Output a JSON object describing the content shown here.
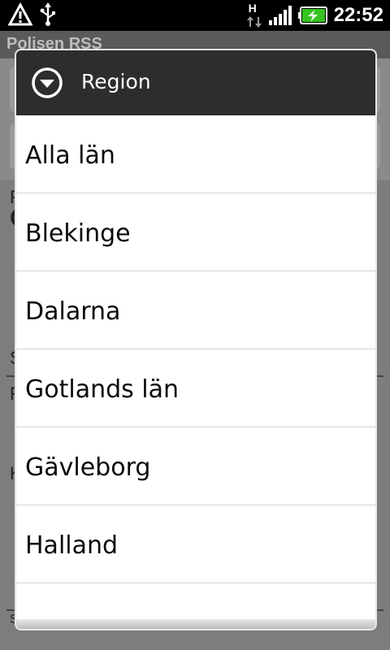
{
  "status_bar": {
    "time": "22:52",
    "icons": [
      "alert-icon",
      "usb-icon",
      "network-hsdpa-icon",
      "signal-icon",
      "battery-charging-icon"
    ],
    "network_label": "H"
  },
  "app": {
    "title": "Polisen RSS",
    "background_fragments": [
      "F",
      "C",
      "S",
      "F",
      "K",
      "S"
    ]
  },
  "dialog": {
    "title": "Region",
    "items": [
      {
        "label": "Alla län"
      },
      {
        "label": "Blekinge"
      },
      {
        "label": "Dalarna"
      },
      {
        "label": "Gotlands län"
      },
      {
        "label": "Gävleborg"
      },
      {
        "label": "Halland"
      },
      {
        "label": ""
      }
    ]
  },
  "colors": {
    "dialog_header": "#2d2d2d",
    "dialog_body": "#ffffff",
    "battery_charge": "#35c220"
  }
}
